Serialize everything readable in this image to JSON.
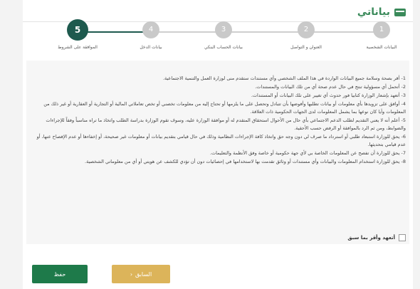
{
  "header": {
    "title": "بياناتي"
  },
  "steps": [
    {
      "number": "1",
      "label": "البيانات الشخصية",
      "state": "inactive"
    },
    {
      "number": "2",
      "label": "العنوان و التواصل",
      "state": "inactive"
    },
    {
      "number": "3",
      "label": "بيانات الحساب البنكي",
      "state": "inactive"
    },
    {
      "number": "4",
      "label": "بيانات الدخل",
      "state": "inactive"
    },
    {
      "number": "5",
      "label": "الموافقة على الشروط",
      "state": "active"
    }
  ],
  "terms": [
    "1- أقر بصحة وسلامة جميع البيانات الواردة في هذا الملف الشخصي وأي مستندات ستقدم منى لوزارة العمل والتنمية الاجتماعية.",
    "2- أتحمل أي مسؤولية تنتج في حال عدم صحة أي من تلك البيانات والمستندات.",
    "3- أتعهد بإشعار الوزارة كتابيا فور حدوث أي تغيير على تلك البيانات أو المستندات.",
    "4- أوافق على تزويدها بأي معلومات أو بيانات تطلبها وأفوضها بأن تتبادل وتحصل على ما يلزمها أو تحتاج إليه من معلومات تخصني أو تخص تعاملاتي المالية أو التجارية أو العقارية أو غير ذلك من المعلومات وأيا كان نوعها بما يشمل المعلومات لدى الجهات الحكومية ذات العلاقة.",
    "5- أعلم أنه لا يعني التقديم لطلب الدعم الاجتماعي بأي حال من الأحوال استحقاق المتقدم له أو موافقة الوزارة عليه، وسوف تقوم الوزارة بدراسة الطلب واتخاذ ما تراه مناسباً وفقاً للإجراءات والضوابط، ومن ثم الرد بالموافقة أو الرفض حسب الأحقية.",
    "6- يحق للوزارة استبعاد طلبي أو استرداد ما صرف لي دون وجه حق واتخاذ كافة الإجراءات النظامية وذلك في حال قيامي بتقديم بيانات أو معلومات غير صحيحة، أو إخفاءها أو عدم الإفصاح عنها، أو عدم قيامي بتحديثها.",
    "7- يحق للوزارة أن تفصح عن المعلومات الخاصة بي لأي جهة حكومية أو خاصة وفق الأنظمة والتعليمات.",
    "8- يحق للوزارة استخدام المعلومات والبيانات وأي مستندات أو وثائق تقدمت بها لاستخدامها في إحصائيات دون أن تؤدي للكشف عن هويتي أو أي من معلوماتي الشخصية."
  ],
  "agree": {
    "label": "أتعهد وأقر بما سبق",
    "checked": false
  },
  "buttons": {
    "save": "حفظ",
    "previous": "السابق"
  },
  "colors": {
    "accent": "#1e5a4e",
    "save": "#1e7a4a",
    "previous": "#dcb45a",
    "title": "#3a8a5a"
  }
}
